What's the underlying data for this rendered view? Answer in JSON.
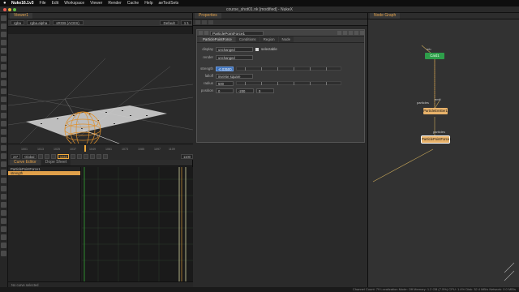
{
  "menubar": {
    "apple": "",
    "app": "Nuke16.1v3",
    "items": [
      "File",
      "Edit",
      "Workspace",
      "Viewer",
      "Render",
      "Cache",
      "Help",
      "aeToolSets"
    ]
  },
  "window": {
    "title": "course_shot01.nk [modified] - NukeX"
  },
  "viewer": {
    "tab": "Viewer1",
    "channels": "rgba",
    "layer": "rgba.alpha",
    "colorspace": "sRGB (ACES)",
    "zoom": "Default",
    "ratio": "1:1",
    "status": "2K_DCI  x=1873 y=14          0.00000  0.28495  0.31137  0.00000    H: 23 S:0.27 V:0.35  L: 0.24021"
  },
  "timeline": {
    "ticks": [
      "1001",
      "1013",
      "1025",
      "1037",
      "1049",
      "1061",
      "1073",
      "1085",
      "1097",
      "1109"
    ],
    "fps": "24*",
    "mode": "Global",
    "frame": "1042",
    "end": "1100"
  },
  "curve": {
    "tabs": [
      "Curve Editor",
      "Dope Sheet"
    ],
    "tree": [
      "ParticlePointForce1",
      "strength"
    ],
    "footer": "No curve selected"
  },
  "properties": {
    "tab": "Properties",
    "node_name": "ParticlePointForce1",
    "tabs": [
      "ParticlePointForce",
      "Conditions",
      "Region",
      "Node"
    ],
    "display_label": "display",
    "display_value": "unchanged",
    "selectable_label": "selectable",
    "render_label": "render",
    "render_value": "unchanged",
    "strength_label": "strength",
    "strength_value": "-0.03500",
    "falloff_label": "falloff",
    "falloff_value": "inverse square",
    "radius_label": "radius",
    "radius_value": "500",
    "position_label": "position",
    "pos_x": "0",
    "pos_y": "-200",
    "pos_z": "0"
  },
  "nodegraph": {
    "tab": "Node Graph",
    "nodes": [
      "mb",
      "Card1",
      "particles",
      "emit",
      "ParticleEmitter1",
      "particles",
      "ParticlePointForce1"
    ]
  },
  "statusbar": {
    "text": "Channel Count: 79  Localization Mode: Off  Memory: 1.2 GB (7.5%)  CPU: 1.4%  Disk: 32.4 MB/s  Network: 0.0 MB/s"
  },
  "colors": {
    "accent": "#f0a93a",
    "selection": "#3a6fb8",
    "card_node": "#2e9e4a",
    "particle_node": "#e8b26a"
  }
}
